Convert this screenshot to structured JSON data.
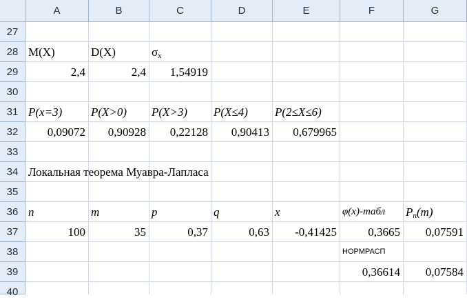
{
  "columns": [
    "A",
    "B",
    "C",
    "D",
    "E",
    "F",
    "G"
  ],
  "rows": [
    "27",
    "28",
    "29",
    "30",
    "31",
    "32",
    "33",
    "34",
    "35",
    "36",
    "37",
    "38",
    "39",
    "40"
  ],
  "cells": {
    "A28": "M(X)",
    "B28": "D(X)",
    "C28_main": "σ",
    "C28_sub": "x",
    "A29": "2,4",
    "B29": "2,4",
    "C29": "1,54919",
    "A31": "P(x=3)",
    "B31": "P(X>0)",
    "C31": "P(X>3)",
    "D31": "P(X≤4)",
    "E31": "P(2≤X≤6)",
    "A32": "0,09072",
    "B32": "0,90928",
    "C32": "0,22128",
    "D32": "0,90413",
    "E32": "0,679965",
    "A34": "Локальная теорема Муавра-Лапласа",
    "A36": "n",
    "B36": "m",
    "C36": "p",
    "D36": "q",
    "E36": "x",
    "F36": "φ(x)-табл",
    "G36_main": "P",
    "G36_sub": "n",
    "G36_tail": "(m)",
    "A37": "100",
    "B37": "35",
    "C37": "0,37",
    "D37": "0,63",
    "E37": "-0,41425",
    "F37": "0,3665",
    "G37": "0,07591",
    "F38": "НОРМРАСП",
    "F39": "0,36614",
    "G39": "0,07584"
  },
  "colors": {
    "header_bg": "#e4ecf7",
    "grid": "#d0d7e5",
    "header_border": "#9eb6ce"
  }
}
